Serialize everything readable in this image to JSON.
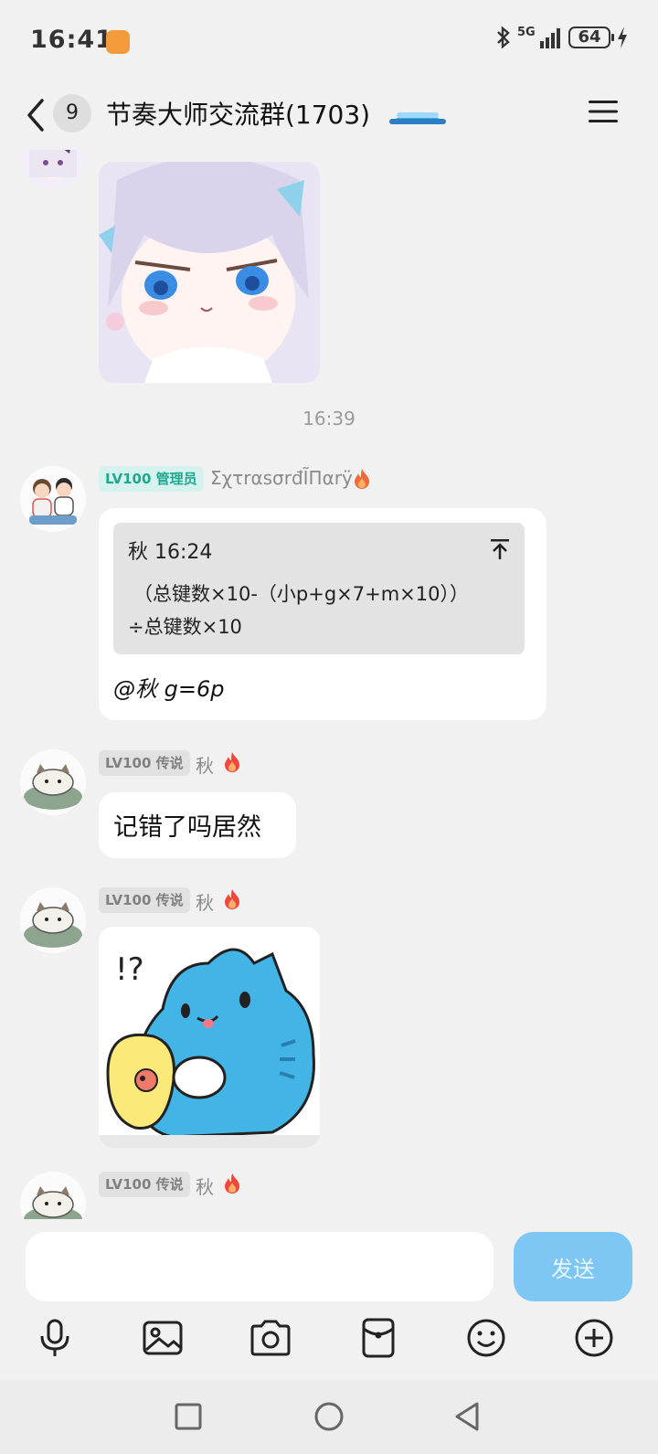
{
  "status_bar": {
    "time": "16:41",
    "network": "5G",
    "battery": "64"
  },
  "header": {
    "unread_count": "9",
    "title": "节奏大师交流群(1703)"
  },
  "messages": {
    "timestamp": "16:39",
    "admin_msg": {
      "badge": "LV100 管理员",
      "sender": "ΣχτrαsσrđĨΠαrÿ",
      "quote_author_time": "秋 16:24",
      "quote_line1": "（总键数×10-（小p+g×7+m×10））",
      "quote_line2": "÷总键数×10",
      "reply": "@秋  g=6p"
    },
    "msg2": {
      "badge": "LV100 传说",
      "sender": "秋",
      "text": "记错了吗居然"
    },
    "msg3": {
      "badge": "LV100 传说",
      "sender": "秋",
      "sticker_text": "!?"
    },
    "msg4": {
      "badge": "LV100 传说",
      "sender": "秋"
    }
  },
  "input": {
    "placeholder": "",
    "send_label": "发送"
  },
  "toolbar": {
    "icons": [
      "microphone-icon",
      "image-icon",
      "camera-icon",
      "red-packet-icon",
      "emoji-icon",
      "plus-icon"
    ]
  },
  "colors": {
    "accent": "#7ec7f5",
    "admin_badge": "#1fa88f",
    "background": "#f1f1f1"
  }
}
